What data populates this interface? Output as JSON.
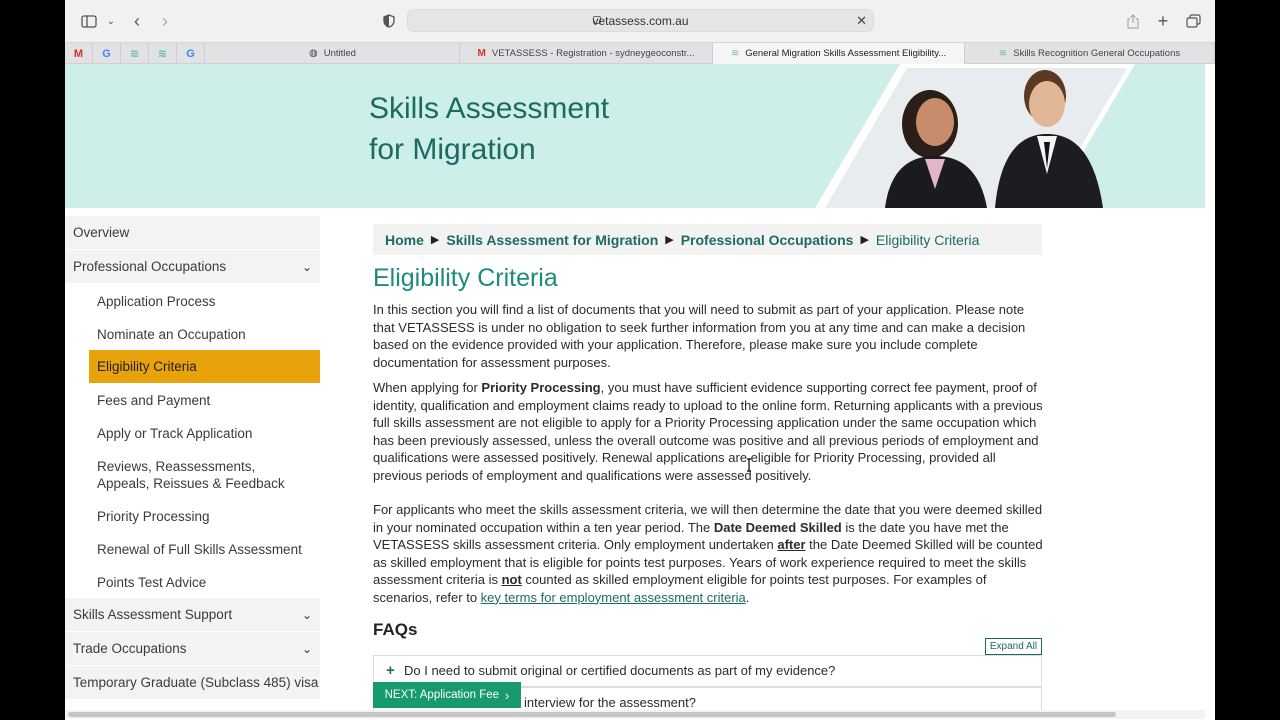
{
  "browser": {
    "url": "vetassess.com.au",
    "pinned_tabs": [
      {
        "icon": "gmail-icon",
        "glyph": "M",
        "color": "#d93025"
      },
      {
        "icon": "google-icon",
        "glyph": "G",
        "color": "#4285f4"
      },
      {
        "icon": "vetassess-icon",
        "glyph": "≋",
        "color": "#6fb7a6"
      },
      {
        "icon": "vetassess-icon",
        "glyph": "≋",
        "color": "#6fb7a6"
      },
      {
        "icon": "google-icon",
        "glyph": "G",
        "color": "#4285f4"
      }
    ],
    "tabs": [
      {
        "label": "Untitled",
        "fav": "◍"
      },
      {
        "label": "VETASSESS - Registration - sydneygeoconstr...",
        "fav": "M"
      },
      {
        "label": "General Migration Skills Assessment Eligibility...",
        "fav": "≋"
      },
      {
        "label": "Skills Recognition General Occupations",
        "fav": "≋"
      }
    ]
  },
  "hero": {
    "title_line1": "Skills Assessment",
    "title_line2": "for Migration"
  },
  "sidebar": {
    "items": [
      {
        "label": "Overview"
      },
      {
        "label": "Professional Occupations"
      },
      {
        "label": "Application Process"
      },
      {
        "label": "Nominate an Occupation"
      },
      {
        "label": "Eligibility Criteria"
      },
      {
        "label": "Fees and Payment"
      },
      {
        "label": "Apply or Track Application"
      },
      {
        "label": "Reviews, Reassessments, Appeals, Reissues & Feedback"
      },
      {
        "label": "Priority Processing"
      },
      {
        "label": "Renewal of Full Skills Assessment"
      },
      {
        "label": "Points Test Advice"
      },
      {
        "label": "Skills Assessment Support"
      },
      {
        "label": "Trade Occupations"
      },
      {
        "label": "Temporary Graduate (Subclass 485) visa"
      }
    ]
  },
  "breadcrumb": {
    "home": "Home",
    "level1": "Skills Assessment for Migration",
    "level2": "Professional Occupations",
    "current": "Eligibility Criteria"
  },
  "main": {
    "title": "Eligibility Criteria",
    "para1": "In this section you will find a list of documents that you will need to submit as part of your application. Please note that VETASSESS is under no obligation to seek further information from you at any time and can make a decision based on the evidence provided with your application. Therefore, please make sure you include complete documentation for assessment purposes.",
    "para2_a": "When applying for ",
    "para2_bold": "Priority Processing",
    "para2_b": ", you must have sufficient evidence supporting correct fee payment, proof of identity, qualification and employment claims ready to upload to the online form. Returning applicants with a previous full skills assessment are not eligible to apply for a Priority Processing application under the same occupation which has been previously assessed, unless the overall outcome was positive and all previous periods of employment and qualifications were assessed positively. Renewal applications are eligible for Priority Processing, provided all previous periods of employment and qualifications were assessed positively.",
    "para3_a": "For applicants who meet the skills assessment criteria, we will then determine the date that you were deemed skilled in your nominated occupation within a ten year period. The ",
    "para3_bold": "Date Deemed Skilled",
    "para3_b": " is the date you have met the VETASSESS skills assessment criteria. Only employment undertaken ",
    "para3_after": "after",
    "para3_c": " the Date Deemed Skilled will be counted as skilled employment that is eligible for points test purposes. Years of work experience required to meet the skills assessment criteria is ",
    "para3_not": "not",
    "para3_d": " counted as skilled employment eligible for points test purposes. For examples of scenarios, refer to ",
    "para3_link": "key terms for employment assessment criteria",
    "para3_e": ".",
    "faq_heading": "FAQs",
    "expand_all": "Expand All",
    "faq_items": [
      {
        "question": "Do I need to submit original or certified documents as part of my evidence?"
      },
      {
        "question": "interview for the assessment?"
      }
    ],
    "next_button": "NEXT: Application Fee"
  },
  "colors": {
    "accent": "#1c6b62",
    "active_nav": "#e8a20c",
    "hero_bg": "#cdeee9",
    "next_button": "#179a6d"
  }
}
